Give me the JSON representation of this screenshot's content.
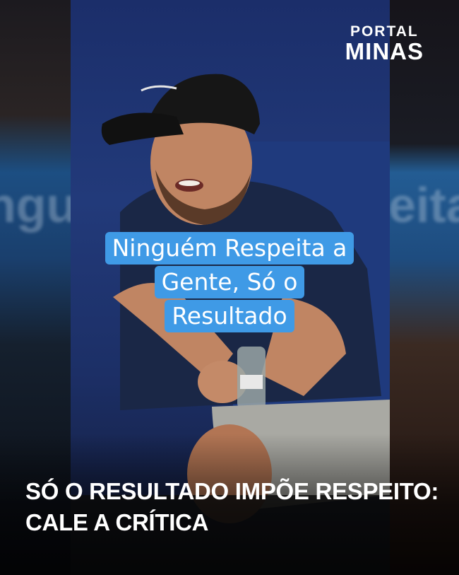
{
  "logo": {
    "line1": "PORTAL",
    "line2": "MINAS"
  },
  "caption": {
    "lines": [
      "Ninguém Respeita a",
      "Gente, Só o",
      "Resultado"
    ]
  },
  "headline": {
    "lines": [
      "SÓ O RESULTADO IMPÕE RESPEITO:",
      "CALE A CRÍTICA"
    ]
  },
  "background_text": {
    "left": "ngu",
    "right": "eita"
  },
  "colors": {
    "caption_bg": "#3f9ae6",
    "text": "#ffffff",
    "backdrop": "#223a7a"
  }
}
